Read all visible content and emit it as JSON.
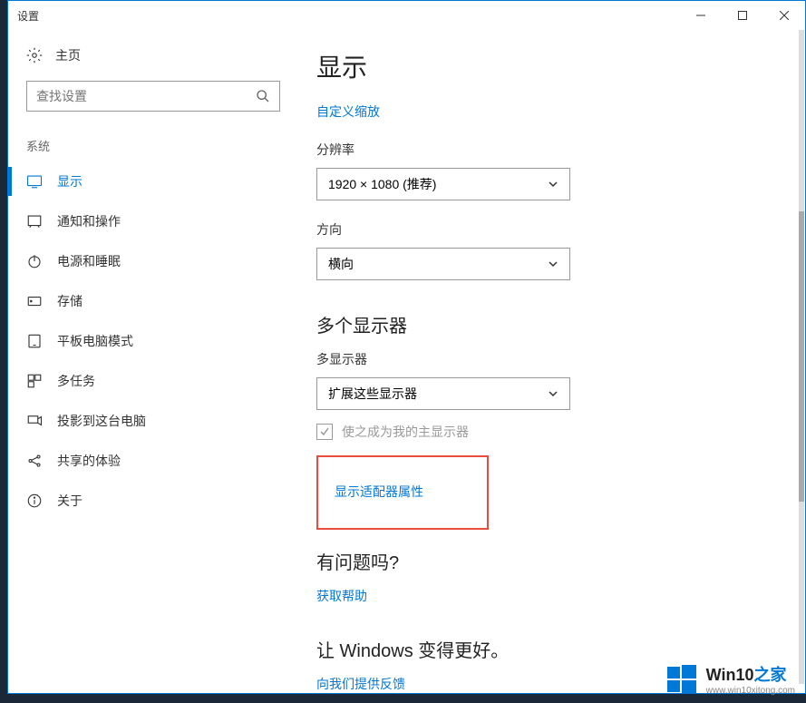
{
  "titlebar": {
    "title": "设置"
  },
  "sidebar": {
    "home": "主页",
    "search_placeholder": "查找设置",
    "section": "系统",
    "items": [
      {
        "label": "显示"
      },
      {
        "label": "通知和操作"
      },
      {
        "label": "电源和睡眠"
      },
      {
        "label": "存储"
      },
      {
        "label": "平板电脑模式"
      },
      {
        "label": "多任务"
      },
      {
        "label": "投影到这台电脑"
      },
      {
        "label": "共享的体验"
      },
      {
        "label": "关于"
      }
    ]
  },
  "main": {
    "page_title": "显示",
    "custom_scaling_link": "自定义缩放",
    "resolution_label": "分辨率",
    "resolution_value": "1920 × 1080 (推荐)",
    "orientation_label": "方向",
    "orientation_value": "横向",
    "multi_displays_heading": "多个显示器",
    "multi_displays_label": "多显示器",
    "multi_displays_value": "扩展这些显示器",
    "make_main_display": "使之成为我的主显示器",
    "adapter_properties_link": "显示适配器属性",
    "questions_heading": "有问题吗?",
    "get_help_link": "获取帮助",
    "improve_heading": "让 Windows 变得更好。",
    "feedback_link": "向我们提供反馈"
  },
  "watermark": {
    "brand_main": "Win10",
    "brand_suffix": "之家",
    "url": "www.win10xitong.com"
  }
}
